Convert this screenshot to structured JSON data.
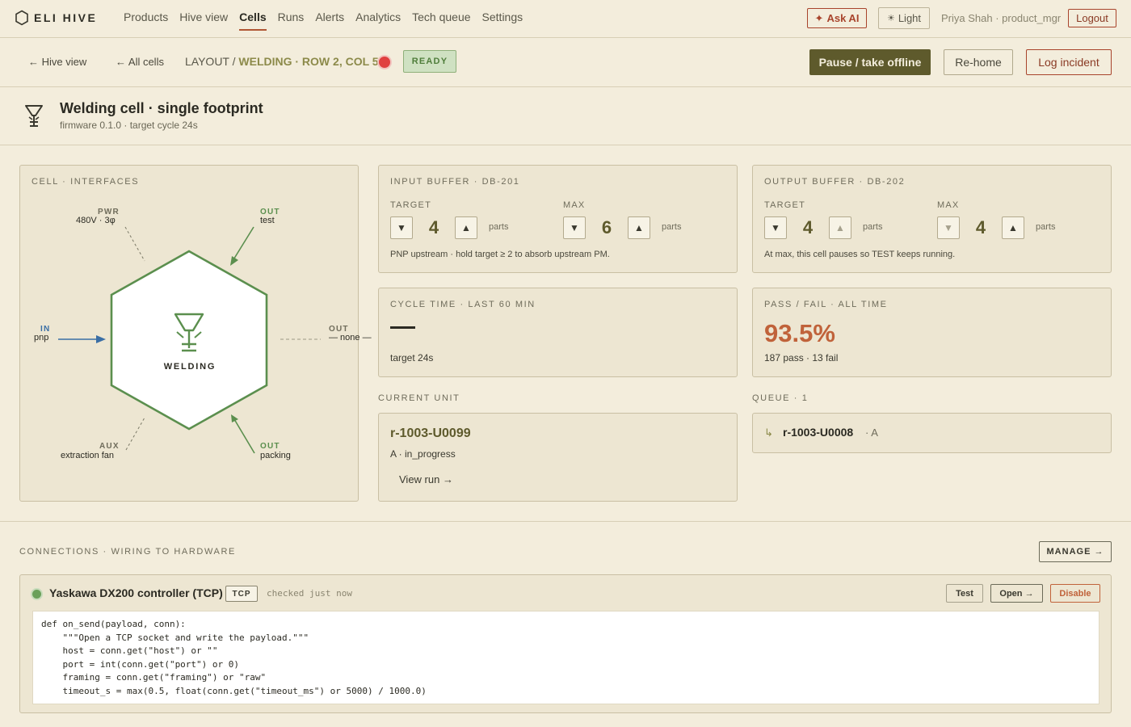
{
  "app": {
    "brand": "ELI HIVE",
    "nav": [
      "Products",
      "Hive view",
      "Cells",
      "Runs",
      "Alerts",
      "Analytics",
      "Tech queue",
      "Settings"
    ],
    "active_nav": "Cells",
    "ask_ai_label": "Ask AI",
    "ask_ai_glyph": "✦",
    "theme_label": "Light",
    "theme_glyph": "☀",
    "user": "Priya Shah · product_mgr",
    "logout_label": "Logout"
  },
  "subbar": {
    "back_hive": "← Hive view",
    "back_cells": "← All cells",
    "crumb_prefix": "LAYOUT / ",
    "crumb_cell": "WELDING · ROW 2, COL 5",
    "status": "READY",
    "status_dot_color": "#e04040",
    "pause_label": "Pause / take offline",
    "rehome_label": "Re-home",
    "incident_label": "Log incident"
  },
  "cell": {
    "title": "Welding cell · single footprint",
    "subtitle": "firmware 0.1.0 · target cycle 24s",
    "icon": "welding-icon"
  },
  "diagram": {
    "label": "CELL · INTERFACES",
    "hex_label": "WELDING",
    "pwr_tag": "PWR",
    "pwr_value": "480V · 3φ",
    "out_test_tag": "OUT",
    "out_test_value": "test",
    "in_tag": "IN",
    "in_value": "pnp",
    "out_right_tag": "OUT",
    "out_right_value": "— none —",
    "aux_tag": "AUX",
    "aux_value": "extraction fan",
    "out_pack_tag": "OUT",
    "out_pack_value": "packing",
    "in_color": "#3a6ea5",
    "out_color": "#5b8f4e"
  },
  "input_buffer": {
    "label": "INPUT BUFFER · DB-201",
    "target_label": "TARGET",
    "target": "4",
    "max_label": "MAX",
    "max": "6",
    "unit": "parts",
    "down_glyph": "▼",
    "up_glyph": "▲",
    "note": "PNP upstream · hold target ≥ 2 to absorb upstream PM."
  },
  "output_buffer": {
    "label": "OUTPUT BUFFER · DB-202",
    "target_label": "TARGET",
    "target": "4",
    "max_label": "MAX",
    "max": "4",
    "unit": "parts",
    "down_glyph": "▼",
    "up_glyph": "▲",
    "note": "At max, this cell pauses so TEST keeps running."
  },
  "cycle": {
    "label": "CYCLE TIME · LAST 60 MIN",
    "value": "—",
    "sub": "target 24s"
  },
  "pass_fail": {
    "label": "PASS / FAIL · ALL TIME",
    "value": "93.5%",
    "sub": "187 pass · 13 fail"
  },
  "current_unit": {
    "caption": "CURRENT UNIT",
    "id": "r-1003-U0099",
    "state": "A · in_progress",
    "link": "View run →"
  },
  "queue": {
    "caption": "QUEUE · 1",
    "arrow": "↳",
    "id": "r-1003-U0008",
    "variant": "· A"
  },
  "connections": {
    "caption": "CONNECTIONS · WIRING TO HARDWARE",
    "manage_label": "MANAGE →",
    "item": {
      "name": "Yaskawa DX200 controller (TCP)",
      "tag": "TCP",
      "checked": "checked just now",
      "test_label": "Test",
      "open_label": "Open →",
      "disable_label": "Disable",
      "code": [
        "def on_send(payload, conn):",
        "    \"\"\"Open a TCP socket and write the payload.\"\"\"",
        "    host = conn.get(\"host\") or \"\"",
        "    port = int(conn.get(\"port\") or 0)",
        "    framing = conn.get(\"framing\") or \"raw\"",
        "    timeout_s = max(0.5, float(conn.get(\"timeout_ms\") or 5000) / 1000.0)"
      ]
    }
  }
}
